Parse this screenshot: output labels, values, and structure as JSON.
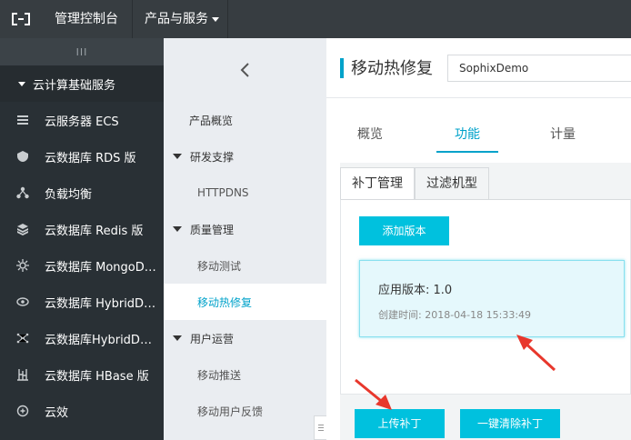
{
  "topbar": {
    "logo": "aliyun-logo-icon",
    "console_label": "管理控制台",
    "products_label": "产品与服务"
  },
  "sidebar": {
    "toggle_label": "III",
    "section_label": "云计算基础服务",
    "items": [
      {
        "label": "云服务器 ECS",
        "icon": "server-icon"
      },
      {
        "label": "云数据库 RDS 版",
        "icon": "database-icon"
      },
      {
        "label": "负载均衡",
        "icon": "load-balancer-icon"
      },
      {
        "label": "云数据库 Redis 版",
        "icon": "redis-icon"
      },
      {
        "label": "云数据库 MongoDB ...",
        "icon": "mongodb-icon"
      },
      {
        "label": "云数据库 HybridDB f...",
        "icon": "hybriddb-icon"
      },
      {
        "label": "云数据库HybridDB f...",
        "icon": "hybriddb-network-icon"
      },
      {
        "label": "云数据库 HBase 版",
        "icon": "hbase-icon"
      },
      {
        "label": "云效",
        "icon": "yunxiao-icon"
      }
    ]
  },
  "subnav": {
    "overview": "产品概览",
    "groups": [
      {
        "label": "研发支撑",
        "children": [
          {
            "label": "HTTPDNS",
            "active": false
          }
        ]
      },
      {
        "label": "质量管理",
        "children": [
          {
            "label": "移动测试",
            "active": false
          },
          {
            "label": "移动热修复",
            "active": true
          }
        ]
      },
      {
        "label": "用户运营",
        "children": [
          {
            "label": "移动推送",
            "active": false
          },
          {
            "label": "移动用户反馈",
            "active": false
          }
        ]
      }
    ]
  },
  "main": {
    "title": "移动热修复",
    "app_select": "SophixDemo",
    "tabs": [
      {
        "label": "概览",
        "active": false
      },
      {
        "label": "功能",
        "active": true
      },
      {
        "label": "计量",
        "active": false
      }
    ],
    "sub_tabs": [
      {
        "label": "补丁管理",
        "active": true
      },
      {
        "label": "过滤机型",
        "active": false
      }
    ],
    "add_version": "添加版本",
    "version_card": {
      "version": "应用版本: 1.0",
      "created": "创建时间: 2018-04-18 15:33:49"
    },
    "upload_patch": "上传补丁",
    "clear_patches": "一键清除补丁"
  },
  "colors": {
    "accent": "#00c1de",
    "accent_text": "#00a2ca",
    "topbar": "#373d41",
    "sidebar": "#293035",
    "annotation_arrow": "#e8372c"
  }
}
